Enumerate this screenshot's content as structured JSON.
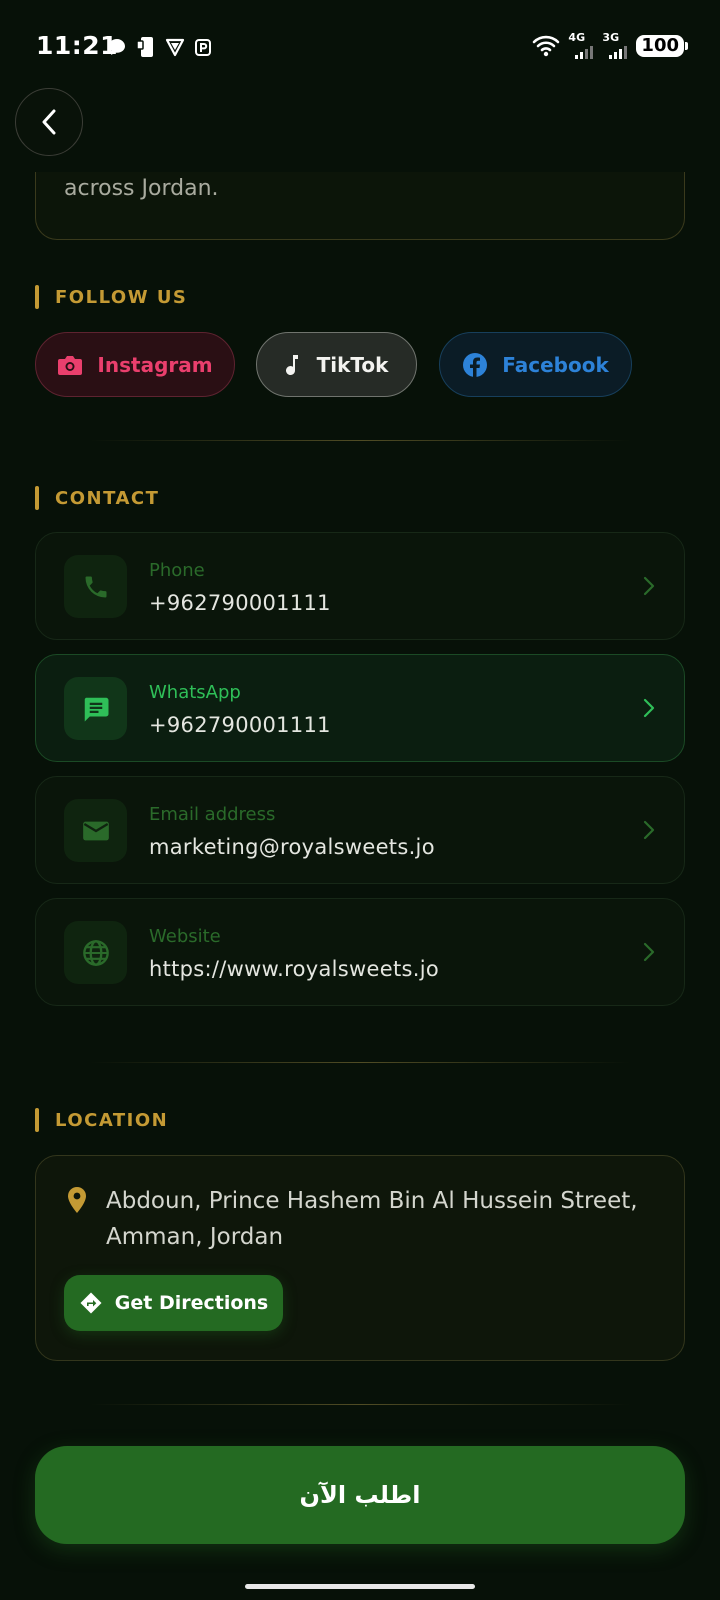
{
  "status_bar": {
    "time": "11:21",
    "network_1": "4G",
    "network_2": "3G",
    "battery": "100"
  },
  "about": {
    "text_tail": "across Jordan."
  },
  "follow": {
    "title": "FOLLOW US",
    "buttons": [
      {
        "label": "Instagram",
        "icon": "camera-icon",
        "color": "#ea3f6d"
      },
      {
        "label": "TikTok",
        "icon": "music-note-icon",
        "color": "#f3f3f0"
      },
      {
        "label": "Facebook",
        "icon": "facebook-icon",
        "color": "#2d82d8"
      }
    ]
  },
  "contact": {
    "title": "CONTACT",
    "items": [
      {
        "label": "Phone",
        "value": "+962790001111",
        "icon": "phone-icon"
      },
      {
        "label": "WhatsApp",
        "value": "+962790001111",
        "icon": "chat-icon"
      },
      {
        "label": "Email address",
        "value": "marketing@royalsweets.jo",
        "icon": "mail-icon"
      },
      {
        "label": "Website",
        "value": "https://www.royalsweets.jo",
        "icon": "globe-icon"
      }
    ]
  },
  "location": {
    "title": "LOCATION",
    "address": "Abdoun, Prince Hashem Bin Al Hussein Street, Amman, Jordan",
    "directions_label": "Get Directions",
    "icon": "location-pin-icon"
  },
  "order_button": {
    "label": "اطلب الآن"
  },
  "colors": {
    "background": "#071108",
    "accent_gold": "#c49a34",
    "primary_green": "#246a22",
    "whatsapp_green": "#2fbf58"
  }
}
